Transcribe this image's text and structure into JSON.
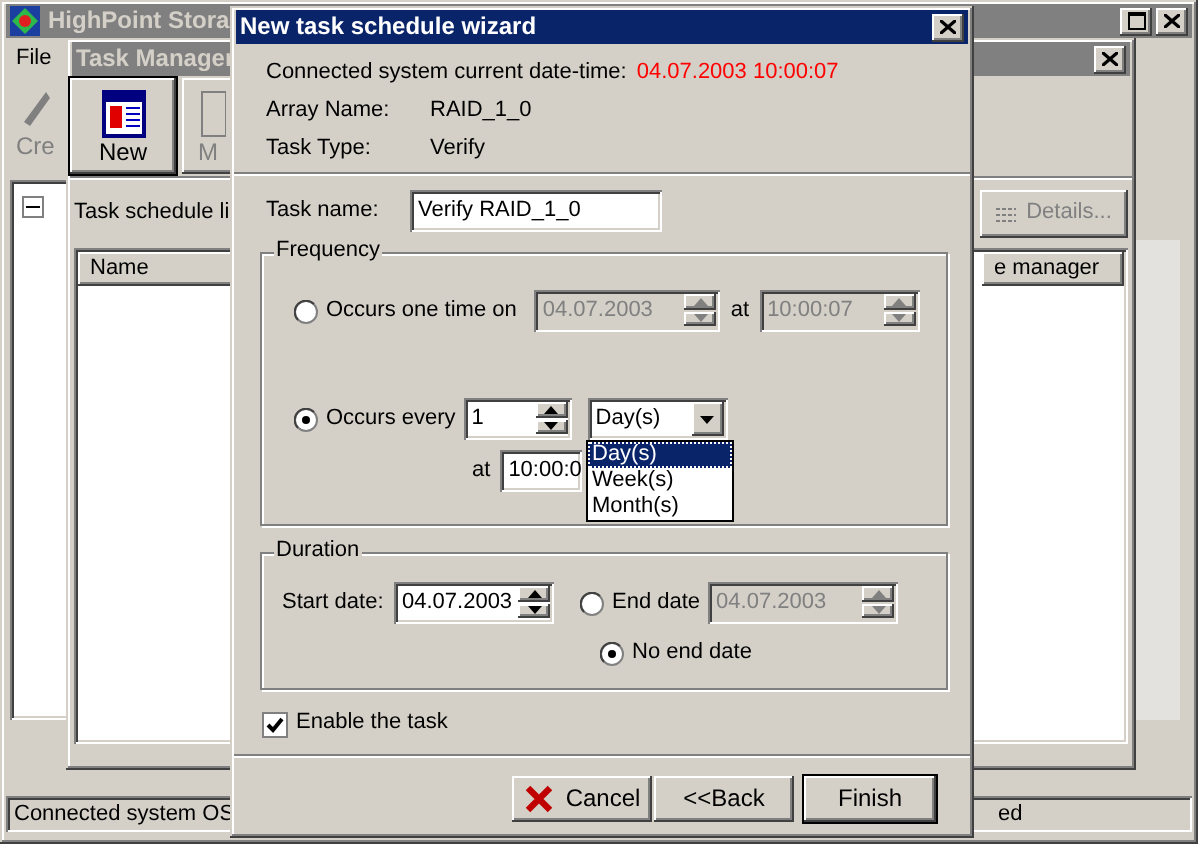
{
  "main_window": {
    "title": "HighPoint Stora",
    "menu": [
      "File"
    ],
    "toolbar": [
      "Cre"
    ],
    "status_bar": [
      "Connected system OS",
      "ed"
    ]
  },
  "task_manager": {
    "title": "Task Manager",
    "toolbar": [
      "New",
      "M"
    ],
    "list_label": "Task schedule li",
    "details_button": {
      "label": "Details...",
      "disabled": true
    },
    "columns": [
      "Name",
      "e manager"
    ]
  },
  "dialog": {
    "title": "New task schedule wizard",
    "info": [
      {
        "label": "Connected system current date-time:",
        "value": "04.07.2003 10:00:07",
        "kind": "highlight"
      },
      {
        "label": "Array Name:",
        "value": "RAID_1_0",
        "kind": "plain"
      },
      {
        "label": "Task Type:",
        "value": "Verify",
        "kind": "plain"
      }
    ],
    "task_name": {
      "label": "Task name:",
      "value": "Verify RAID_1_0"
    },
    "frequency": {
      "title": "Frequency",
      "one_time": {
        "label": "Occurs one time on",
        "selected": false,
        "date": "04.07.2003",
        "at": "at",
        "time": "10:00:07"
      },
      "recurring": {
        "label": "Occurs every",
        "selected": true,
        "count": "1",
        "unit": "Day(s)",
        "at": "at",
        "time": "10:00:0"
      },
      "unit_options": [
        {
          "label": "Day(s)",
          "selected": true
        },
        {
          "label": "Week(s)",
          "selected": false
        },
        {
          "label": "Month(s)",
          "selected": false
        }
      ]
    },
    "duration": {
      "title": "Duration",
      "start_label": "Start date:",
      "start_date": "04.07.2003",
      "end_date": {
        "label": "End date",
        "selected": false,
        "date": "04.07.2003"
      },
      "no_end_date": {
        "label": "No end date",
        "selected": true
      }
    },
    "enable": {
      "label": "Enable the task",
      "checked": true
    },
    "buttons": [
      {
        "label": "Cancel",
        "kind": "cancel",
        "default": false
      },
      {
        "label": "<<Back",
        "kind": "plain",
        "default": false
      },
      {
        "label": "Finish",
        "kind": "plain",
        "default": true
      }
    ]
  }
}
